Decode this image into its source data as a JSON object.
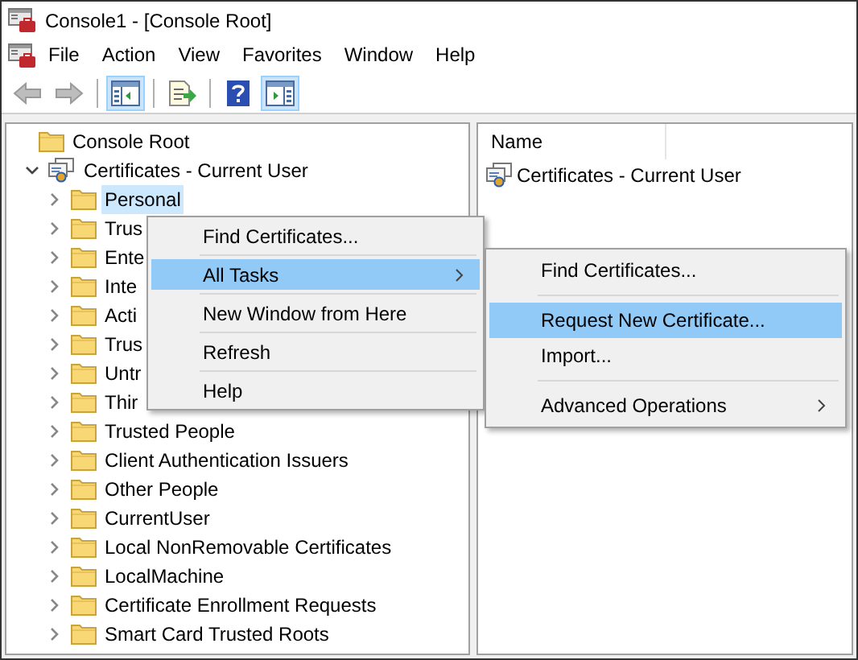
{
  "window": {
    "title": "Console1 - [Console Root]"
  },
  "menu_bar": [
    "File",
    "Action",
    "View",
    "Favorites",
    "Window",
    "Help"
  ],
  "toolbar": [
    {
      "kind": "back",
      "disabled": true,
      "pressed": false
    },
    {
      "kind": "forward",
      "disabled": true,
      "pressed": false
    },
    {
      "kind": "separator"
    },
    {
      "kind": "tree",
      "pressed": true
    },
    {
      "kind": "separator"
    },
    {
      "kind": "export",
      "pressed": false
    },
    {
      "kind": "separator"
    },
    {
      "kind": "help",
      "pressed": false
    },
    {
      "kind": "actions",
      "pressed": true
    }
  ],
  "tree": [
    {
      "label": "Console Root",
      "kind": "folder",
      "selected": false,
      "children": [
        {
          "label": "Certificates - Current User",
          "kind": "snapin",
          "selected": false,
          "expanded": true,
          "children": [
            {
              "label": "Personal",
              "kind": "folder",
              "selected": true,
              "expanded": false
            },
            {
              "label": "Trus",
              "kind": "folder",
              "selected": false,
              "expanded": false
            },
            {
              "label": "Ente",
              "kind": "folder",
              "selected": false,
              "expanded": false
            },
            {
              "label": "Inte",
              "kind": "folder",
              "selected": false,
              "expanded": false
            },
            {
              "label": "Acti",
              "kind": "folder",
              "selected": false,
              "expanded": false
            },
            {
              "label": "Trus",
              "kind": "folder",
              "selected": false,
              "expanded": false
            },
            {
              "label": "Untr",
              "kind": "folder",
              "selected": false,
              "expanded": false
            },
            {
              "label": "Thir",
              "kind": "folder",
              "selected": false,
              "expanded": false
            },
            {
              "label": "Trusted People",
              "kind": "folder",
              "selected": false,
              "expanded": false
            },
            {
              "label": "Client Authentication Issuers",
              "kind": "folder",
              "selected": false,
              "expanded": false
            },
            {
              "label": "Other People",
              "kind": "folder",
              "selected": false,
              "expanded": false
            },
            {
              "label": "CurrentUser",
              "kind": "folder",
              "selected": false,
              "expanded": false
            },
            {
              "label": "Local NonRemovable Certificates",
              "kind": "folder",
              "selected": false,
              "expanded": false
            },
            {
              "label": "LocalMachine",
              "kind": "folder",
              "selected": false,
              "expanded": false
            },
            {
              "label": "Certificate Enrollment Requests",
              "kind": "folder",
              "selected": false,
              "expanded": false
            },
            {
              "label": "Smart Card Trusted Roots",
              "kind": "folder",
              "selected": false,
              "expanded": false
            }
          ]
        }
      ]
    }
  ],
  "list": {
    "columns": [
      "Name"
    ],
    "rows": [
      {
        "name": "Certificates - Current User"
      }
    ]
  },
  "context_menu": [
    {
      "kind": "item",
      "label": "Find Certificates...",
      "selected": false,
      "submenu": false
    },
    {
      "kind": "separator"
    },
    {
      "kind": "item",
      "label": "All Tasks",
      "selected": true,
      "submenu": true
    },
    {
      "kind": "separator"
    },
    {
      "kind": "item",
      "label": "New Window from Here",
      "selected": false,
      "submenu": false
    },
    {
      "kind": "separator"
    },
    {
      "kind": "item",
      "label": "Refresh",
      "selected": false,
      "submenu": false
    },
    {
      "kind": "separator"
    },
    {
      "kind": "item",
      "label": "Help",
      "selected": false,
      "submenu": false
    }
  ],
  "submenu": [
    {
      "kind": "item",
      "label": "Find Certificates...",
      "selected": false,
      "submenu": false
    },
    {
      "kind": "separator"
    },
    {
      "kind": "item",
      "label": "Request New Certificate...",
      "selected": true,
      "submenu": false
    },
    {
      "kind": "item",
      "label": "Import...",
      "selected": false,
      "submenu": false
    },
    {
      "kind": "separator"
    },
    {
      "kind": "item",
      "label": "Advanced Operations",
      "selected": false,
      "submenu": true
    }
  ]
}
